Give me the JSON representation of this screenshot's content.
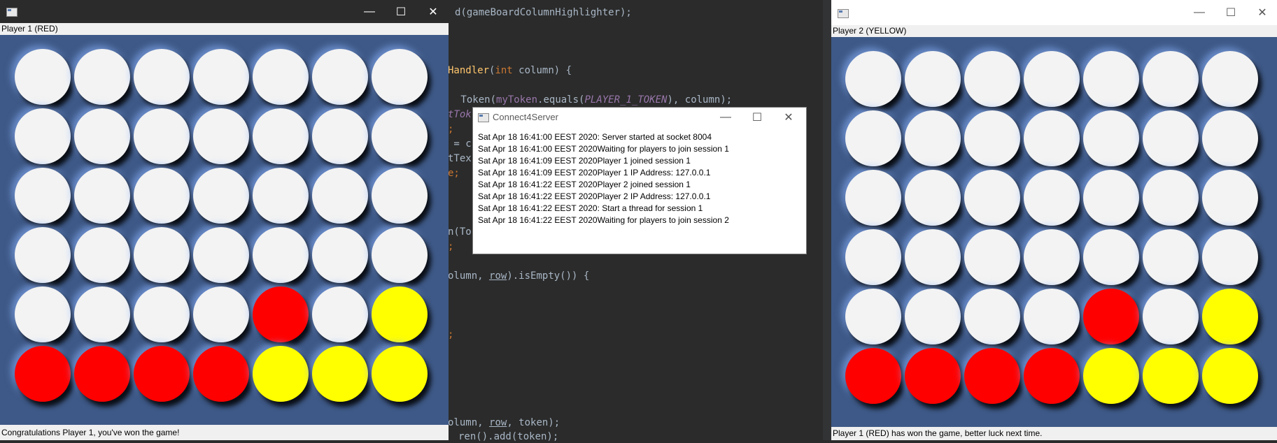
{
  "ide": {
    "lines": [
      {
        "parts": [
          {
            "t": "d(gameBoardColumnHighlighter);",
            "c": ""
          }
        ]
      },
      {
        "parts": [
          {
            "t": "Handler",
            "c": "fn"
          },
          {
            "t": "(",
            "c": ""
          },
          {
            "t": "int",
            "c": "kw"
          },
          {
            "t": " column) {",
            "c": ""
          }
        ]
      },
      {
        "parts": [
          {
            "t": " Token(",
            "c": ""
          },
          {
            "t": "myToken",
            "c": "pu"
          },
          {
            "t": ".equals(",
            "c": ""
          },
          {
            "t": "PLAYER_1_TOKEN",
            "c": "it"
          },
          {
            "t": "), column);",
            "c": ""
          }
        ]
      },
      {
        "parts": [
          {
            "t": "tTok",
            "c": "it"
          }
        ]
      },
      {
        "parts": [
          {
            "t": ";",
            "c": "kw"
          }
        ]
      },
      {
        "parts": [
          {
            "t": " = c",
            "c": ""
          }
        ]
      },
      {
        "parts": [
          {
            "t": "tTex",
            "c": ""
          }
        ]
      },
      {
        "parts": [
          {
            "t": "e;",
            "c": "kw"
          }
        ]
      },
      {
        "parts": [
          {
            "t": "n(To",
            "c": ""
          }
        ]
      },
      {
        "parts": [
          {
            "t": ";",
            "c": "kw"
          }
        ]
      },
      {
        "parts": [
          {
            "t": "olumn, ",
            "c": ""
          },
          {
            "t": "row",
            "c": "ul"
          },
          {
            "t": ").isEmpty()) {",
            "c": ""
          }
        ]
      },
      {
        "parts": [
          {
            "t": ";",
            "c": "kw"
          }
        ]
      },
      {
        "parts": [
          {
            "t": "olumn, ",
            "c": ""
          },
          {
            "t": "row",
            "c": "ul"
          },
          {
            "t": ", token);",
            "c": ""
          }
        ]
      },
      {
        "parts": [
          {
            "t": "ren().add(token);",
            "c": ""
          }
        ]
      }
    ]
  },
  "player1": {
    "window_title": "",
    "label": "Player 1 (RED)",
    "status": "Congratulations Player 1, you've won the game!",
    "controls": {
      "minimize": "—",
      "maximize": "☐",
      "close": "✕"
    }
  },
  "player2": {
    "window_title": "",
    "label": "Player 2 (YELLOW)",
    "status": "Player 1 (RED) has won the game, better luck next time.",
    "controls": {
      "minimize": "—",
      "maximize": "☐",
      "close": "✕"
    }
  },
  "board": {
    "rows": 6,
    "cols": 7,
    "cells": [
      [
        "empty",
        "empty",
        "empty",
        "empty",
        "empty",
        "empty",
        "empty"
      ],
      [
        "empty",
        "empty",
        "empty",
        "empty",
        "empty",
        "empty",
        "empty"
      ],
      [
        "empty",
        "empty",
        "empty",
        "empty",
        "empty",
        "empty",
        "empty"
      ],
      [
        "empty",
        "empty",
        "empty",
        "empty",
        "empty",
        "empty",
        "empty"
      ],
      [
        "empty",
        "empty",
        "empty",
        "empty",
        "red",
        "empty",
        "yellow"
      ],
      [
        "red",
        "red",
        "red",
        "red",
        "yellow",
        "yellow",
        "yellow"
      ]
    ]
  },
  "server": {
    "window_title": "Connect4Server",
    "controls": {
      "minimize": "—",
      "maximize": "☐",
      "close": "✕"
    },
    "log": [
      "Sat Apr 18 16:41:00 EEST 2020: Server started at socket 8004",
      "Sat Apr 18 16:41:00 EEST 2020Waiting for players to join session 1",
      "Sat Apr 18 16:41:09 EEST 2020Player 1 joined session 1",
      "Sat Apr 18 16:41:09 EEST 2020Player 1 IP Address: 127.0.0.1",
      "Sat Apr 18 16:41:22 EEST 2020Player 2 joined session 1",
      "Sat Apr 18 16:41:22 EEST 2020Player 2 IP Address: 127.0.0.1",
      "Sat Apr 18 16:41:22 EEST 2020: Start a thread for session 1",
      "Sat Apr 18 16:41:22 EEST 2020Waiting for players to join session 2"
    ]
  },
  "colors": {
    "board": "#3e5987",
    "red": "#ff0000",
    "yellow": "#ffff00",
    "empty": "#f3f3f3"
  },
  "icons": [
    "app-window-icon",
    "minimize-icon",
    "maximize-icon",
    "close-icon"
  ]
}
